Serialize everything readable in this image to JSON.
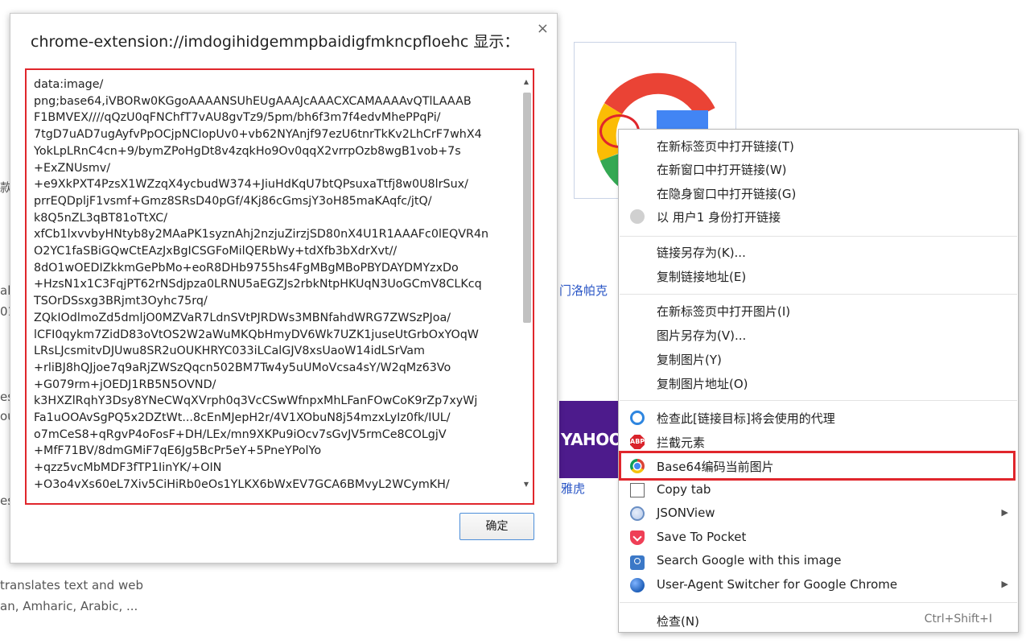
{
  "background": {
    "left_fragments": [
      "款",
      "al",
      "01",
      "es",
      "ou",
      "es"
    ],
    "link_zh": "门洛帕克",
    "yahoo_logo": "YAHOO!",
    "yahoo_zh": "雅虎",
    "desc_line1": "translates text and web",
    "desc_line2": "an, Amharic, Arabic, ..."
  },
  "dialog": {
    "title": "chrome-extension://imdogihidgemmpbaidigfmkncpfloehc 显示：",
    "close_label": "×",
    "content": "data:image/\npng;base64,iVBORw0KGgoAAAANSUhEUgAAAJcAAACXCAMAAAAvQTlLAAAB\nF1BMVEX////qQzU0qFNChfT7vAU8gvTz9/5pm/bh6f3m7f4edvMhePPqPi/\n7tgD7uAD7ugAyfvPpOCjpNCIopUv0+vb62NYAnjf97ezU6tnrTkKv2LhCrF7whX4\nYokLpLRnC4cn+9/bymZPoHgDt8v4zqkHo9Ov0qqX2vrrpOzb8wgB1vob+7s\n+ExZNUsmv/\n+e9XkPXT4PzsX1WZzqX4ycbudW374+JiuHdKqU7btQPsuxaTtfj8w0U8lrSux/\nprrEQDpljF1vsmf+Gmz8SRsD40pGf/4Kj86cGmsjY3oH85maKAqfc/jtQ/\nk8Q5nZL3qBT81oTtXC/\nxfCb1lxvvbyHNtyb8y2MAaPK1syznAhj2nzjuZirzjSD80nX4U1R1AAAFc0lEQVR4n\nO2YC1faSBiGQwCtEAzJxBgICSGFoMilQERbWy+tdXfb3bXdrXvt//\n8dO1wOEDIZkkmGePbMo+eoR8DHb9755hs4FgMBgMBoPBYDAYDMYzxDo\n+HzsN1x1C3FqjPT62rNSdjpza0LRNU5aEGZJs2rbkNtpHKUqN3UoGCmV8CLKcq\nTSOrDSsxg3BRjmt3Oyhc75rq/\nZQkIOdlmoZd5dmljO0MZVaR7LdnSVtPJRDWs3MBNfahdWRG7ZWSzPJoa/\nlCFI0qykm7ZidD83oVtOS2W2aWuMKQbHmyDV6Wk7UZK1juseUtGrbOxYOqW\nLRsLJcsmitvDJUwu8SR2uOUKHRYC033iLCalGJV8xsUaoW14idLSrVam\n+rliBJ8hQJjoe7q9aRjZWSzQqcn502BM7Tw4y5uUMoVcsa4sY/W2qMz63Vo\n+G079rm+jOEDJ1RB5N5OVND/\nk3HXZlRqhY3Dsy8YNeCWqXVrph0q3VcCSwWfnpxMhLFanFOwCoK9rZp7xyWj\nFa1uOOAvSgPQ5x2DZtWt...8cEnMJepH2r/4V1XObuN8j54mzxLyIz0fk/IUL/\no7mCeS8+qRgvP4oFosF+DH/LEx/mn9XKPu9iOcv7sGvJV5rmCe8COLgjV\n+MfF71BV/8dmGMiF7qE6Jg5BcPr5eY+5PneYPolYo\n+qzz5vcMbMDF3fTP1IinYK/+OIN\n+O3o4vXs60eL7Xiv5CiHiRb0eOs1YLKX6bWxEV7GCA6BMvyL2WCymKH/"
  },
  "ok_button": {
    "label": "确定"
  },
  "context_menu": {
    "items": [
      {
        "label": "在新标签页中打开链接(T)"
      },
      {
        "label": "在新窗口中打开链接(W)"
      },
      {
        "label": "在隐身窗口中打开链接(G)"
      },
      {
        "label": "以 用户1 身份打开链接",
        "icon": "user-avatar-icon"
      },
      {
        "label": "链接另存为(K)..."
      },
      {
        "label": "复制链接地址(E)"
      },
      {
        "label": "在新标签页中打开图片(I)"
      },
      {
        "label": "图片另存为(V)..."
      },
      {
        "label": "复制图片(Y)"
      },
      {
        "label": "复制图片地址(O)"
      },
      {
        "label": "检查此[链接目标]将会使用的代理",
        "icon": "proxy-ring-icon"
      },
      {
        "label": "拦截元素",
        "icon": "adblock-icon"
      },
      {
        "label": "Base64编码当前图片",
        "icon": "chrome-extension-icon"
      },
      {
        "label": "Copy tab",
        "icon": "copy-tab-icon"
      },
      {
        "label": "JSONView",
        "icon": "jsonview-icon"
      },
      {
        "label": "Save To Pocket",
        "icon": "pocket-icon"
      },
      {
        "label": "Search Google with this image",
        "icon": "camera-icon"
      },
      {
        "label": "User-Agent Switcher for Google Chrome",
        "icon": "globe-icon"
      },
      {
        "label": "检查(N)"
      }
    ],
    "inspect_shortcut": "Ctrl+Shift+I",
    "abp_badge": "ABP",
    "submenu_arrow": "▶"
  },
  "colors": {
    "annotation_red": "#e0262c",
    "link_blue": "#2a56c6",
    "yahoo_purple": "#4d1b8c"
  }
}
